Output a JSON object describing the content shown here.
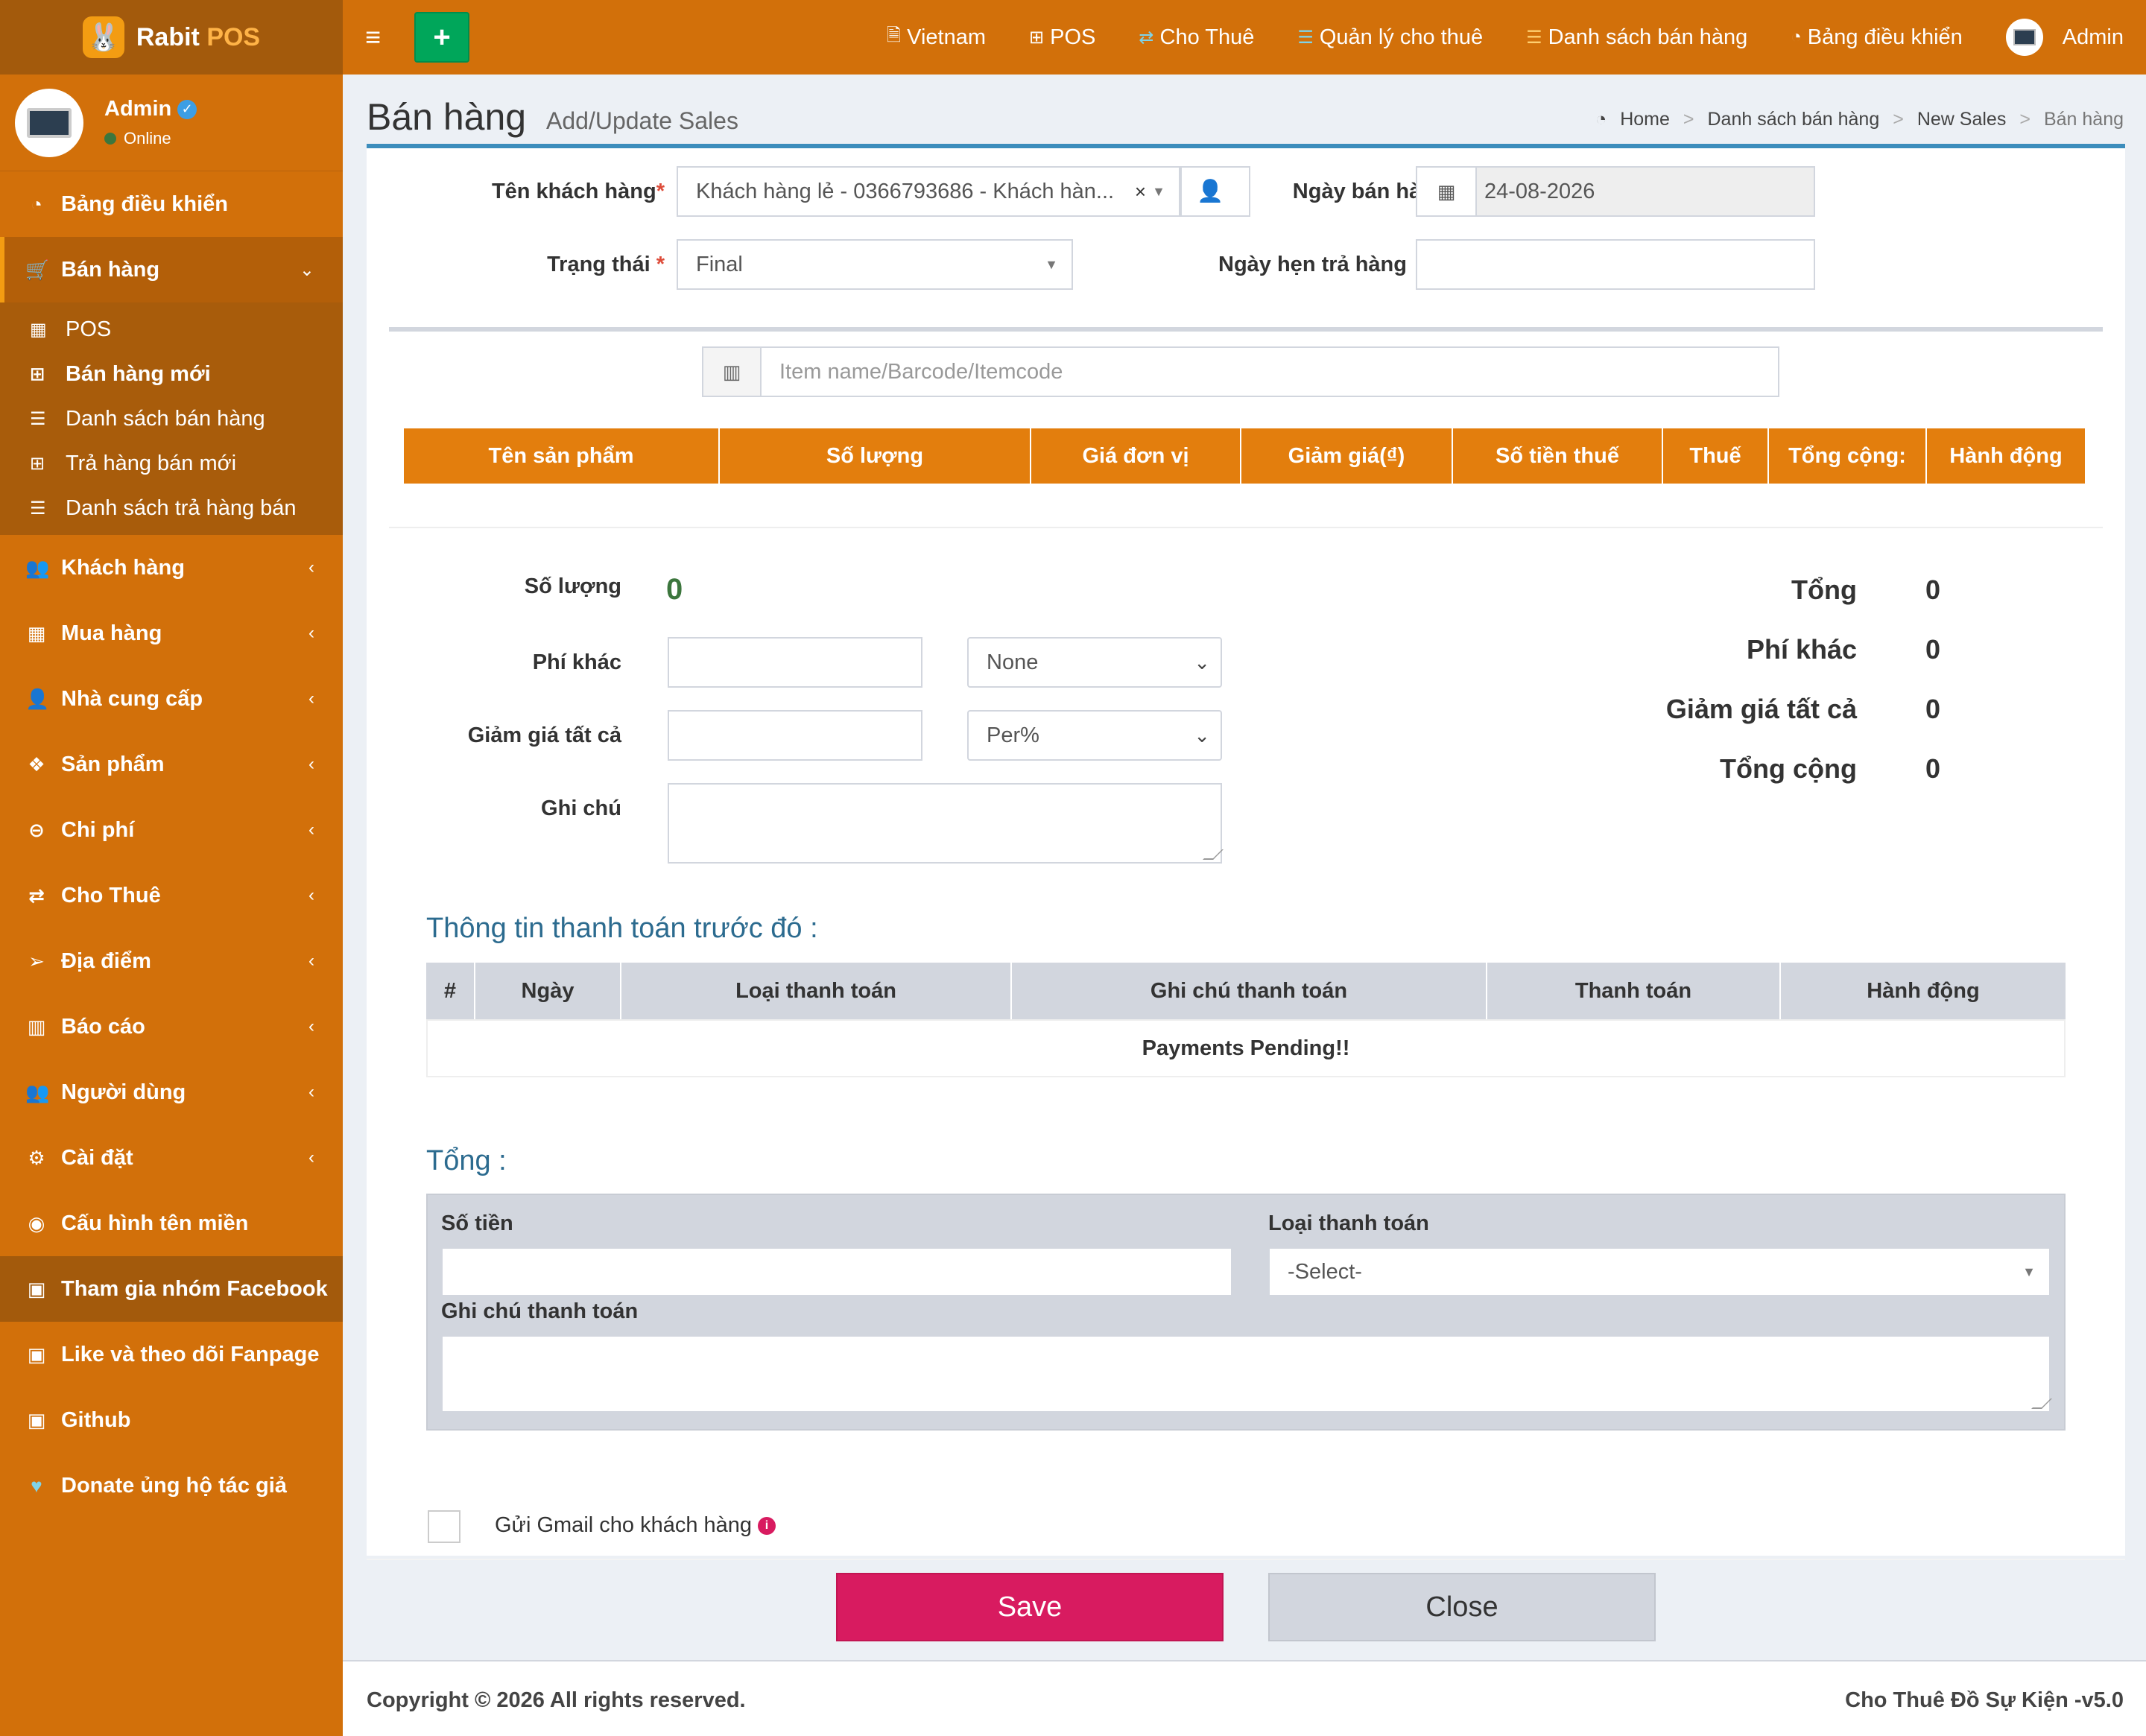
{
  "app": {
    "logo_main": "Rabit",
    "logo_accent": "POS"
  },
  "user": {
    "name": "Admin",
    "status": "Online"
  },
  "sidebar": {
    "dashboard": "Bảng điều khiển",
    "sales": "Bán hàng",
    "sales_sub": [
      "POS",
      "Bán hàng mới",
      "Danh sách bán hàng",
      "Trả hàng bán mới",
      "Danh sách trả hàng bán"
    ],
    "customers": "Khách hàng",
    "purchases": "Mua hàng",
    "suppliers": "Nhà cung cấp",
    "products": "Sản phẩm",
    "expenses": "Chi phí",
    "rental": "Cho Thuê",
    "places": "Địa điểm",
    "reports": "Báo cáo",
    "users": "Người dùng",
    "settings": "Cài đặt",
    "domain": "Cấu hình tên miền",
    "facebook": "Tham gia nhóm Facebook",
    "fanpage": "Like và theo dõi Fanpage",
    "github": "Github",
    "donate": "Donate ủng hộ tác giả"
  },
  "topbar": {
    "language": "Vietnam",
    "pos": "POS",
    "rental": "Cho Thuê",
    "rental_manage": "Quản lý cho thuê",
    "sales_list": "Danh sách bán hàng",
    "dashboard": "Bảng điều khiển",
    "admin": "Admin"
  },
  "header": {
    "title": "Bán hàng",
    "subtitle": "Add/Update Sales",
    "breadcrumb": [
      "Home",
      "Danh sách bán hàng",
      "New Sales",
      "Bán hàng"
    ]
  },
  "form": {
    "customer_label": "Tên khách hàng",
    "customer_value": "Khách hàng lẻ - 0366793686 - Khách hàn...",
    "sale_date_label": "Ngày bán hàng",
    "sale_date_value": "24-08-2026",
    "status_label": "Trạng thái",
    "status_value": "Final",
    "due_date_label": "Ngày hẹn trả hàng",
    "due_date_value": "",
    "item_search_placeholder": "Item name/Barcode/Itemcode"
  },
  "item_table": {
    "columns": [
      "Tên sản phẩm",
      "Số lượng",
      "Giá đơn vị",
      "Giảm giá(₫)",
      "Số tiền thuế",
      "Thuế",
      "Tổng cộng:",
      "Hành động"
    ]
  },
  "summary": {
    "qty_label": "Số lượng",
    "qty_value": "0",
    "other_fee_label": "Phí khác",
    "other_fee_option": "None",
    "discount_label": "Giảm giá tất cả",
    "discount_option": "Per%",
    "note_label": "Ghi chú",
    "total_label": "Tổng",
    "total_value": "0",
    "fee_label": "Phí khác",
    "fee_value": "0",
    "discount_all_label": "Giảm giá tất cả",
    "discount_all_value": "0",
    "grand_total_label": "Tổng cộng",
    "grand_total_value": "0"
  },
  "payments": {
    "title": "Thông tin thanh toán trước đó :",
    "columns": [
      "#",
      "Ngày",
      "Loại thanh toán",
      "Ghi chú thanh toán",
      "Thanh toán",
      "Hành động"
    ],
    "empty_message": "Payments Pending!!"
  },
  "payment_entry": {
    "title": "Tổng :",
    "amount_label": "Số tiền",
    "type_label": "Loại thanh toán",
    "type_value": "-Select-",
    "note_label": "Ghi chú thanh toán"
  },
  "send_gmail_label": "Gửi Gmail cho khách hàng",
  "buttons": {
    "save": "Save",
    "close": "Close"
  },
  "footer": {
    "copyright": "Copyright © 2026 All rights reserved.",
    "version": "Cho Thuê Đồ Sự Kiện -v5.0"
  },
  "colors": {
    "sidebar": "#d2700a",
    "header_table": "#e37e0d",
    "save": "#d81b60",
    "accent": "#3c8dbc"
  }
}
